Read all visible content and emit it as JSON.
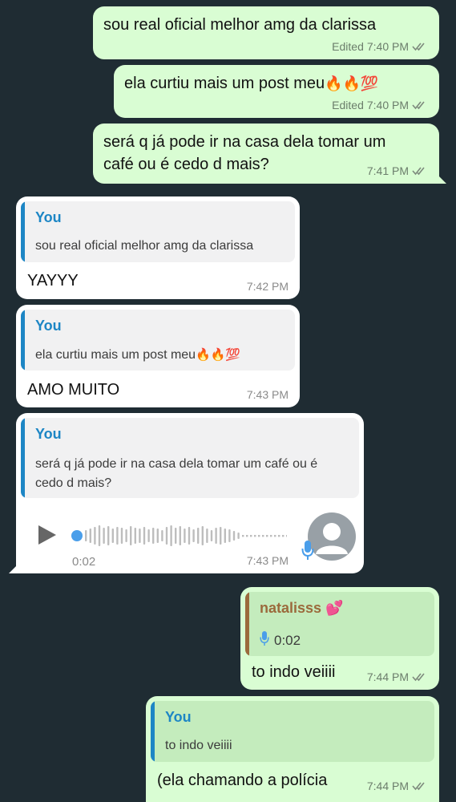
{
  "colors": {
    "background": "#1f2c33",
    "outgoing_bubble": "#d9fdd3",
    "incoming_bubble": "#ffffff",
    "quote_you": "#1d86c5",
    "quote_natalisss": "#9b6a3c",
    "voice_accent": "#4a9eea"
  },
  "messages": [
    {
      "text": "sou real oficial melhor amg da clarissa",
      "edited": "Edited",
      "time": "7:40 PM",
      "status_icon": "double-check-icon"
    },
    {
      "text": "ela curtiu mais um post meu",
      "emojis": "🔥🔥💯",
      "edited": "Edited",
      "time": "7:40 PM",
      "status_icon": "double-check-icon"
    },
    {
      "text_line1": "será q já pode ir na casa dela tomar um",
      "text_line2": "café ou é cedo d mais?",
      "time": "7:41 PM",
      "status_icon": "double-check-icon"
    },
    {
      "quote_author": "You",
      "quote_text": "sou real oficial melhor amg da clarissa",
      "text": "YAYYY",
      "time": "7:42 PM"
    },
    {
      "quote_author": "You",
      "quote_text": "ela curtiu mais um post meu",
      "quote_emojis": "🔥🔥💯",
      "text": "AMO MUITO",
      "time": "7:43 PM"
    },
    {
      "quote_author": "You",
      "quote_text_line1": "será q já pode ir na casa dela tomar um café ou é",
      "quote_text_line2": "cedo d mais?",
      "voice_duration": "0:02",
      "time": "7:43 PM",
      "play_icon": "play-icon",
      "avatar_icon": "avatar-icon",
      "mic_icon": "microphone-icon"
    },
    {
      "quote_author": "natalisss",
      "quote_author_emoji": "💕",
      "quote_voice_duration": "0:02",
      "text": "to indo veiiii",
      "time": "7:44 PM",
      "status_icon": "double-check-icon"
    },
    {
      "quote_author": "You",
      "quote_text": "to indo veiiii",
      "text": "(ela chamando a polícia",
      "time": "7:44 PM",
      "status_icon": "double-check-icon"
    }
  ]
}
